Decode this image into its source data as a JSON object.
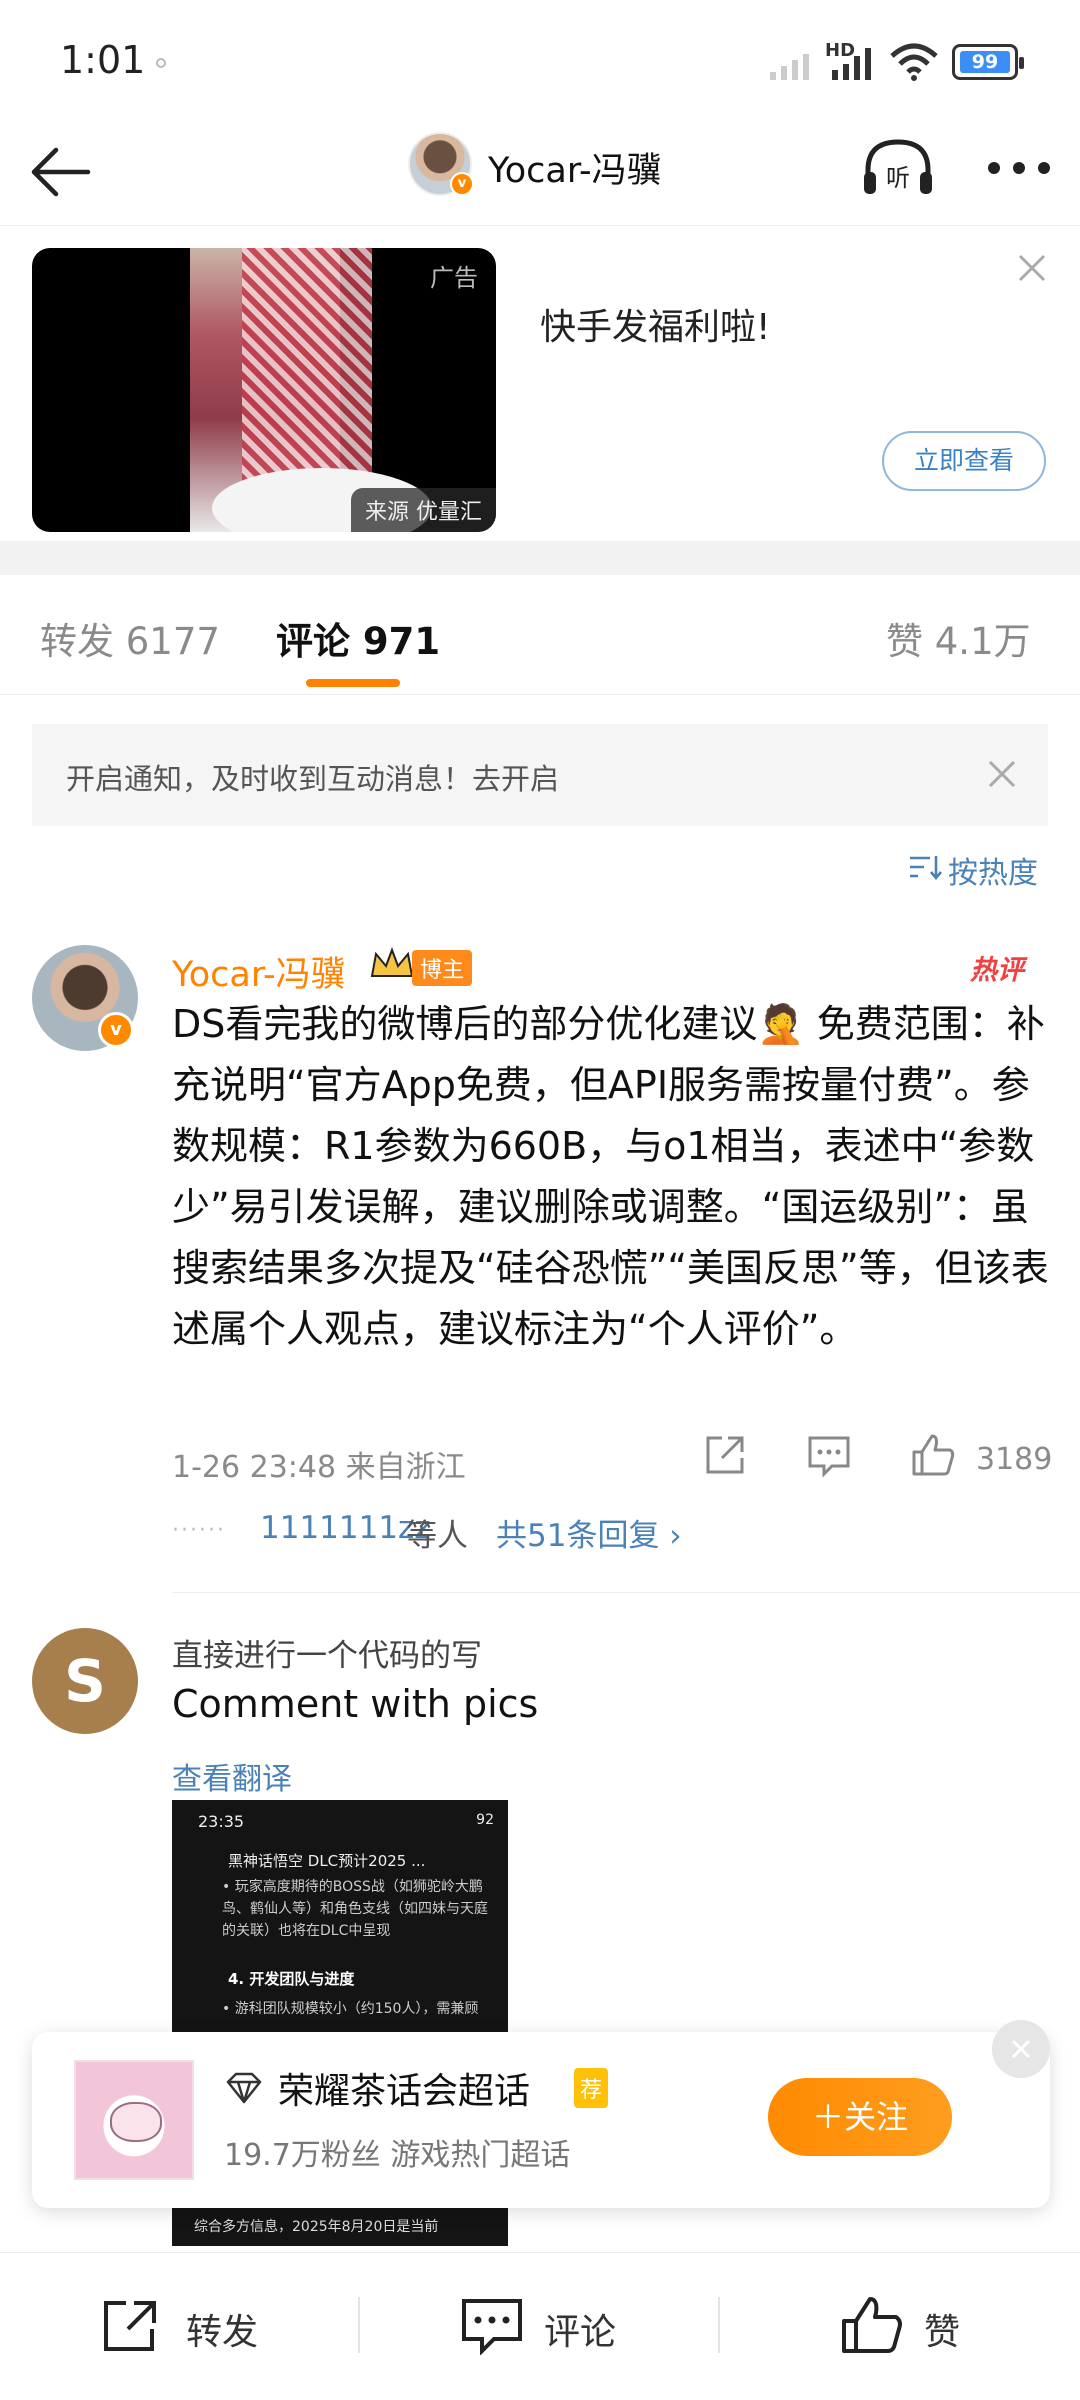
{
  "status_bar": {
    "time": "1:01",
    "network": "HD",
    "battery": "99"
  },
  "header": {
    "title": "Yocar-冯骥"
  },
  "ad": {
    "tag": "广告",
    "source": "来源 优量汇",
    "headline": "快手发福利啦!",
    "cta": "立即查看"
  },
  "tabs": [
    {
      "label": "转发 6177"
    },
    {
      "label": "评论 971"
    },
    {
      "label": "赞 4.1万"
    }
  ],
  "notice": {
    "text": "开启通知，及时收到互动消息！去开启"
  },
  "sort": {
    "label": "按热度"
  },
  "comment1": {
    "author": "Yocar-冯骥",
    "badge": "博主",
    "hot_tag": "热评",
    "body": "DS看完我的微博后的部分优化建议🤦 免费范围：补充说明“官方App免费，但API服务需按量付费”。参数规模：R1参数为660B，与o1相当，表述中“参数少”易引发误解，建议删除或调整。“国运级别”：虽搜索结果多次提及“硅谷恐慌”“美国反思”等，但该表述属个人观点，建议标注为“个人评价”。",
    "meta": "1-26 23:48  来自浙江",
    "likes": "3189",
    "reply_dots": "······",
    "reply_users": "1111111zz",
    "reply_suffix": "等人",
    "reply_total": "共51条回复 ›"
  },
  "comment2": {
    "avatar_letter": "S",
    "author": "直接进行一个代码的写",
    "body": "Comment with pics",
    "translate": "查看翻译",
    "screenshot": {
      "time": "23:35",
      "status": "92",
      "title": "黑神话悟空 DLC预计2025 ...",
      "line1": "• 玩家高度期待的BOSS战（如狮驼岭大鹏鸟、鹤仙人等）和角色支线（如四妹与天庭的关联）也将在DLC中呈现",
      "heading": "4. 开发团队与进度",
      "line2": "• 游科团队规模较小（约150人），需兼顾",
      "footer": "综合多方信息，2025年8月20日是当前"
    }
  },
  "super_topic": {
    "name": "荣耀茶话会超话",
    "tag": "荐",
    "subtitle": "19.7万粉丝  游戏热门超话",
    "follow": "＋关注"
  },
  "bottom_bar": {
    "repost": "转发",
    "comment": "评论",
    "like": "赞"
  },
  "colors": {
    "accent": "#ff8200",
    "link": "#4a82b8"
  }
}
